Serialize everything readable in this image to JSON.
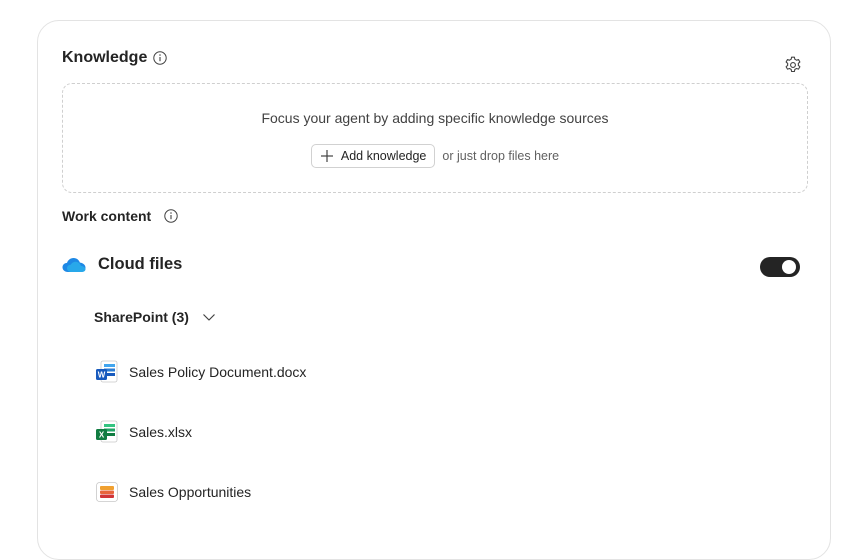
{
  "knowledge": {
    "title": "Knowledge",
    "info_icon": "info-icon",
    "settings_icon": "gear-icon"
  },
  "dropzone": {
    "text": "Focus your agent by adding specific knowledge sources",
    "add_button_label": "Add knowledge",
    "add_icon": "plus-icon",
    "drop_hint": "or just drop files here"
  },
  "work_content": {
    "title": "Work content",
    "info_icon": "info-icon"
  },
  "cloud_files": {
    "title": "Cloud files",
    "icon": "onedrive-cloud-icon",
    "toggle_on": true
  },
  "sharepoint": {
    "label": "SharePoint (3)",
    "chevron_icon": "chevron-down-icon"
  },
  "files": [
    {
      "name": "Sales Policy Document.docx",
      "icon": "word-icon"
    },
    {
      "name": "Sales.xlsx",
      "icon": "excel-icon"
    },
    {
      "name": "Sales Opportunities",
      "icon": "loop-icon"
    }
  ],
  "colors": {
    "toggle_on": "#242424",
    "card_border": "#e3e3e3",
    "word_blue": "#185abd",
    "excel_green": "#107c41",
    "onedrive_blue": "#0f78d4"
  }
}
